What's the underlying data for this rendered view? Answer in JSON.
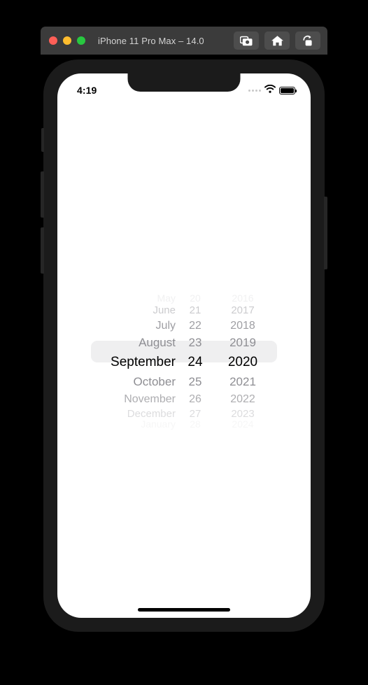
{
  "window": {
    "title": "iPhone 11 Pro Max – 14.0",
    "traffic_lights": [
      {
        "name": "close",
        "color": "#ff5f57"
      },
      {
        "name": "minimize",
        "color": "#ffbd2e"
      },
      {
        "name": "zoom",
        "color": "#28c840"
      }
    ],
    "toolbar": [
      {
        "icon": "screenshot-icon",
        "label": "Screenshot"
      },
      {
        "icon": "home-icon",
        "label": "Home"
      },
      {
        "icon": "rotate-icon",
        "label": "Rotate"
      }
    ],
    "titlebar_color": "#3b3b3b"
  },
  "device": {
    "bezel_color": "#1b1b1b",
    "screen_color": "#ffffff",
    "side_buttons": [
      "silent-switch",
      "volume-up",
      "volume-down",
      "power"
    ]
  },
  "status_bar": {
    "time": "4:19",
    "cellular_icon": "cellular-dots-icon",
    "wifi_icon": "wifi-icon",
    "battery_icon": "battery-icon"
  },
  "date_picker": {
    "selected": {
      "month": "September",
      "day": "24",
      "year": "2020"
    },
    "highlight_color": "#efeff0",
    "rows": [
      {
        "month": "May",
        "day": "20",
        "year": "2016",
        "state": "r-0"
      },
      {
        "month": "June",
        "day": "21",
        "year": "2017",
        "state": "r-1"
      },
      {
        "month": "July",
        "day": "22",
        "year": "2018",
        "state": "r-2"
      },
      {
        "month": "August",
        "day": "23",
        "year": "2019",
        "state": "r-3"
      },
      {
        "month": "September",
        "day": "24",
        "year": "2020",
        "state": "r-sel"
      },
      {
        "month": "October",
        "day": "25",
        "year": "2021",
        "state": "r-5"
      },
      {
        "month": "November",
        "day": "26",
        "year": "2022",
        "state": "r-6"
      },
      {
        "month": "December",
        "day": "27",
        "year": "2023",
        "state": "r-7"
      },
      {
        "month": "January",
        "day": "28",
        "year": "2024",
        "state": "r-8"
      }
    ]
  },
  "home_indicator": {
    "label": "home-indicator"
  }
}
